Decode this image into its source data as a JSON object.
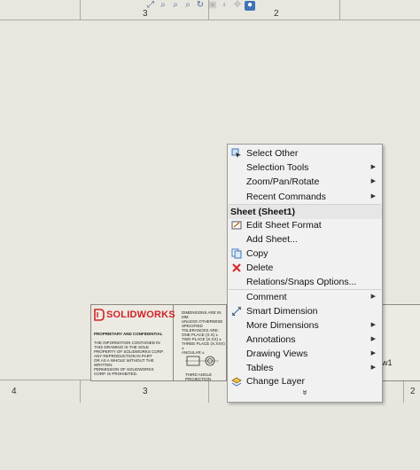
{
  "zones": {
    "top": [
      "3",
      "2"
    ],
    "bottom": [
      "4",
      "3",
      "2"
    ]
  },
  "toolbar": {
    "icons": [
      "zoom-to-fit-icon",
      "zoom-to-area-icon",
      "zoom-in-out-icon",
      "zoom-to-selection-icon",
      "rotate-icon",
      "view-display-icon",
      "hide-show-icon",
      "move-icon",
      "appearance-icon"
    ]
  },
  "titleblock": {
    "logo": "SOLIDWORKS",
    "proprietary": "PROPRIETARY AND CONFIDENTIAL",
    "proprietary_text": "THE INFORMATION CONTAINED IN\nTHIS DRAWING IS THE SOLE\nPROPERTY OF SOLIDWORKS CORP.\nANY REPRODUCTION IN PART\nOR AS A WHOLE WITHOUT THE WRITTEN\nPERMISSION OF SOLIDWORKS\nCORP. IS PROHIBITED.",
    "dimensions_text": "DIMENSIONS ARE IN MM\nUNLESS OTHERWISE SPECIFIED\nTOLERANCES ARE:\nONE PLACE (X.X) ±\nTWO PLACE (X.XX) ±\nTHREE PLACE (X.XXX) ±\nANGULAR ±",
    "projection_text": "THIRD ANGLE PROJECTION",
    "sheet_name_fragment": "w1"
  },
  "menu": {
    "items": [
      {
        "label": "Select Other",
        "icon": "select-other-icon",
        "arrow": false
      },
      {
        "label": "Selection Tools",
        "icon": "",
        "arrow": true
      },
      {
        "label": "Zoom/Pan/Rotate",
        "icon": "",
        "arrow": true
      },
      {
        "label": "Recent Commands",
        "icon": "",
        "arrow": true
      }
    ],
    "header": "Sheet (Sheet1)",
    "sheet_items": [
      {
        "label": "Edit Sheet Format",
        "icon": "edit-sheet-format-icon",
        "arrow": false
      },
      {
        "label": "Add Sheet...",
        "icon": "",
        "arrow": false
      },
      {
        "label": "Copy",
        "icon": "copy-icon",
        "arrow": false
      },
      {
        "label": "Delete",
        "icon": "delete-icon",
        "arrow": false
      },
      {
        "label": "Relations/Snaps Options...",
        "icon": "",
        "arrow": false
      },
      {
        "label": "Comment",
        "icon": "",
        "arrow": true
      },
      {
        "label": "Smart Dimension",
        "icon": "smart-dimension-icon",
        "arrow": false
      },
      {
        "label": "More Dimensions",
        "icon": "",
        "arrow": true
      },
      {
        "label": "Annotations",
        "icon": "",
        "arrow": true
      },
      {
        "label": "Drawing Views",
        "icon": "",
        "arrow": true
      },
      {
        "label": "Tables",
        "icon": "",
        "arrow": true
      },
      {
        "label": "Change Layer",
        "icon": "change-layer-icon",
        "arrow": false
      }
    ],
    "more_icon": "double-chevron-down-icon"
  },
  "colors": {
    "brand_red": "#d32228",
    "delete_red": "#d9262b",
    "accent_blue": "#3e74b8"
  }
}
